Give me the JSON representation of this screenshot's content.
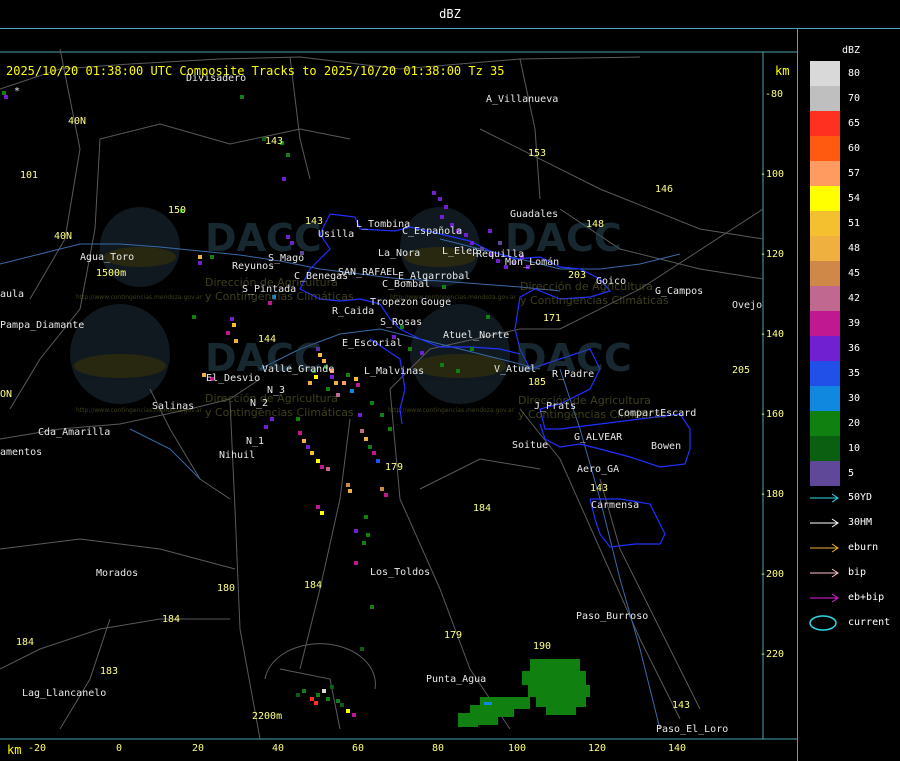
{
  "window": {
    "title": "dBZ"
  },
  "header": {
    "composite_text": "2025/10/20 01:38:00 UTC Composite Tracks to 2025/10/20 01:38:00 Tz 35",
    "unit_top": "km",
    "unit_bottom": "km"
  },
  "axes": {
    "x_ticks": [
      "-20",
      "0",
      "20",
      "40",
      "60",
      "80",
      "100",
      "120",
      "140"
    ],
    "y_ticks": [
      "-80",
      "-100",
      "-120",
      "-140",
      "-160",
      "-180",
      "-200",
      "-220"
    ]
  },
  "legend": {
    "title": "dBZ",
    "entries": [
      {
        "label": "80",
        "color": "#d9d9d9"
      },
      {
        "label": "70",
        "color": "#bfbfbf"
      },
      {
        "label": "65",
        "color": "#ff3020"
      },
      {
        "label": "60",
        "color": "#ff5a10"
      },
      {
        "label": "57",
        "color": "#ff9a60"
      },
      {
        "label": "54",
        "color": "#ffff00"
      },
      {
        "label": "51",
        "color": "#f5c030"
      },
      {
        "label": "48",
        "color": "#f0b040"
      },
      {
        "label": "45",
        "color": "#d08848"
      },
      {
        "label": "42",
        "color": "#c06890"
      },
      {
        "label": "39",
        "color": "#c01890"
      },
      {
        "label": "36",
        "color": "#7020d0"
      },
      {
        "label": "35",
        "color": "#2050e8"
      },
      {
        "label": "30",
        "color": "#1088e0"
      },
      {
        "label": "20",
        "color": "#108010"
      },
      {
        "label": "10",
        "color": "#0a6010"
      },
      {
        "label": "5",
        "color": "#604898"
      }
    ]
  },
  "tracks": [
    {
      "label": "50YD",
      "color": "#30d8e8"
    },
    {
      "label": "30HM",
      "color": "#ffffff"
    },
    {
      "label": "eburn",
      "color": "#f0b040"
    },
    {
      "label": "bip",
      "color": "#ffc0c8"
    },
    {
      "label": "eb+bip",
      "color": "#e020e0"
    },
    {
      "label": "current",
      "color": "#30d8e8"
    }
  ],
  "places_white": [
    {
      "name": "Divisadero"
    },
    {
      "name": "A_Villanueva"
    },
    {
      "name": "Guadales"
    },
    {
      "name": "Usilla"
    },
    {
      "name": "L_Tombina"
    },
    {
      "name": "La_Nora"
    },
    {
      "name": "C_Española"
    },
    {
      "name": "L_Elep"
    },
    {
      "name": "Requilla"
    },
    {
      "name": "Mon_Lomán"
    },
    {
      "name": "Goico"
    },
    {
      "name": "G_Campos"
    },
    {
      "name": "Ovejo"
    },
    {
      "name": "Agua_Toro"
    },
    {
      "name": "Reyunos"
    },
    {
      "name": "S_Mago"
    },
    {
      "name": "C_Benegas"
    },
    {
      "name": "SAN_RAFAEL"
    },
    {
      "name": "E_Algarrobal"
    },
    {
      "name": "C_Bombal"
    },
    {
      "name": "S_Pintada"
    },
    {
      "name": "Tropezon"
    },
    {
      "name": "Gouge"
    },
    {
      "name": "R_Caida"
    },
    {
      "name": "S_Rosas"
    },
    {
      "name": "Pampa_Diamante"
    },
    {
      "name": "Atuel_Norte"
    },
    {
      "name": "E_Escorial"
    },
    {
      "name": "Valle_Grande"
    },
    {
      "name": "L_Malvinas"
    },
    {
      "name": "V_Atuel"
    },
    {
      "name": "R_Padre"
    },
    {
      "name": "El_Desvio"
    },
    {
      "name": "N_3"
    },
    {
      "name": "N_2"
    },
    {
      "name": "Salinas"
    },
    {
      "name": "J_Prats"
    },
    {
      "name": "CompartEscard"
    },
    {
      "name": "Cda_Amarilla"
    },
    {
      "name": "N_1"
    },
    {
      "name": "G_ALVEAR"
    },
    {
      "name": "Bowen"
    },
    {
      "name": "Nihuil"
    },
    {
      "name": "Soitue"
    },
    {
      "name": "amentos"
    },
    {
      "name": "Aero_GA"
    },
    {
      "name": "Carmensa"
    },
    {
      "name": "Morados"
    },
    {
      "name": "Los_Toldos"
    },
    {
      "name": "Paso_Burroso"
    },
    {
      "name": "Punta_Agua"
    },
    {
      "name": "Lag_Llancanelo"
    },
    {
      "name": "Paso_El_Loro"
    },
    {
      "name": "aula"
    }
  ],
  "places_yellow": [
    {
      "name": "143"
    },
    {
      "name": "153"
    },
    {
      "name": "146"
    },
    {
      "name": "101"
    },
    {
      "name": "150"
    },
    {
      "name": "148"
    },
    {
      "name": "40N"
    },
    {
      "name": "40N"
    },
    {
      "name": "143"
    },
    {
      "name": "203"
    },
    {
      "name": "171"
    },
    {
      "name": "144"
    },
    {
      "name": "185"
    },
    {
      "name": "205"
    },
    {
      "name": "179"
    },
    {
      "name": "184"
    },
    {
      "name": "184"
    },
    {
      "name": "180"
    },
    {
      "name": "184"
    },
    {
      "name": "179"
    },
    {
      "name": "184"
    },
    {
      "name": "190"
    },
    {
      "name": "183"
    },
    {
      "name": "143"
    },
    {
      "name": "143"
    },
    {
      "name": "1500m"
    },
    {
      "name": "2200m"
    },
    {
      "name": "ON"
    }
  ],
  "watermark": {
    "brand": "DACC",
    "line1": "Dirección de Agricultura",
    "line2": "y Contingencias Climáticas",
    "url": "http://www.contingencias.mendoza.gov.ar"
  },
  "markers": [
    {
      "name": "*"
    }
  ]
}
